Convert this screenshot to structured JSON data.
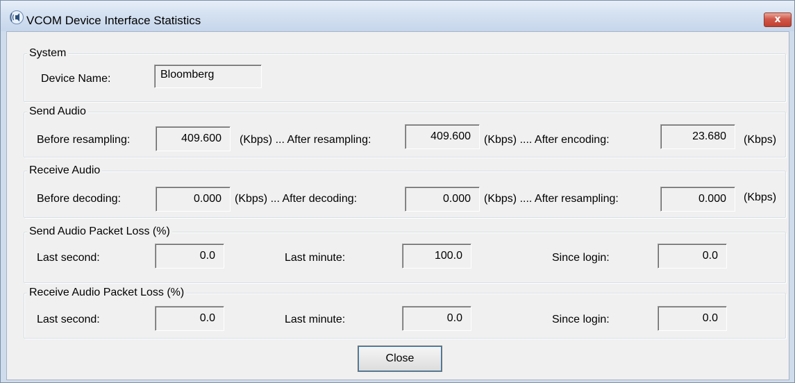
{
  "window": {
    "title": "VCOM Device Interface Statistics",
    "icon": "speaker-waves-icon",
    "close_glyph": "x"
  },
  "system": {
    "title": "System",
    "device_name_label": "Device Name:",
    "device_name_value": "Bloomberg"
  },
  "send_audio": {
    "title": "Send Audio",
    "before_label": "Before resampling:",
    "before_value": "409.600",
    "unit1": "(Kbps) ... After resampling:",
    "after_resampling_value": "409.600",
    "unit2": "(Kbps) ....  After encoding:",
    "after_encoding_value": "23.680",
    "unit3": "(Kbps)"
  },
  "receive_audio": {
    "title": "Receive Audio",
    "before_label": "Before decoding:",
    "before_value": "0.000",
    "unit1": "(Kbps) ...  After decoding:",
    "after_decoding_value": "0.000",
    "unit2": "(Kbps) .... After resampling:",
    "after_resampling_value": "0.000",
    "unit3": "(Kbps)"
  },
  "send_loss": {
    "title": "Send Audio Packet Loss (%)",
    "last_second_label": "Last second:",
    "last_second_value": "0.0",
    "last_minute_label": "Last minute:",
    "last_minute_value": "100.0",
    "since_login_label": "Since login:",
    "since_login_value": "0.0"
  },
  "receive_loss": {
    "title": "Receive Audio Packet Loss (%)",
    "last_second_label": "Last second:",
    "last_second_value": "0.0",
    "last_minute_label": "Last minute:",
    "last_minute_value": "0.0",
    "since_login_label": "Since login:",
    "since_login_value": "0.0"
  },
  "buttons": {
    "close_label": "Close"
  },
  "colors": {
    "titlebar": "#d4e1f1",
    "dialog_bg": "#f0f0f0",
    "close_button": "#c94a3a"
  }
}
